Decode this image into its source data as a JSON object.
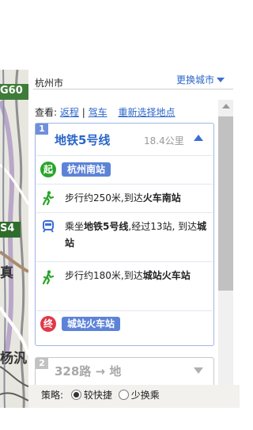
{
  "map": {
    "labels": [
      "G60",
      "S4",
      "真",
      "杨汎"
    ]
  },
  "header": {
    "city": "杭州市",
    "change_city": "更换城市"
  },
  "viewline": {
    "label": "查看:",
    "return_link": "返程",
    "separator": "|",
    "drive_link": "驾车",
    "reselect_link": "重新选择地点"
  },
  "route1": {
    "index": "1",
    "title": "地铁5号线",
    "distance": "18.4公里",
    "start_badge": "起",
    "start_name": "杭州南站",
    "walk1": {
      "prefix": "步行约250米,到达",
      "target": "火车南站"
    },
    "ride": {
      "prefix": "乘坐",
      "line": "地铁5号线",
      "middle": ",经过13站, 到达",
      "target": "城站"
    },
    "walk2": {
      "prefix": "步行约180米,到达",
      "target": "城站火车站"
    },
    "end_badge": "终",
    "end_name": "城站火车站"
  },
  "route2": {
    "index": "2",
    "title": "328路 → 地"
  },
  "strategy": {
    "label": "策略:",
    "option1": "较快捷",
    "option2": "少换乘"
  },
  "colors": {
    "accent": "#2b66c9",
    "start": "#2aa52a",
    "end": "#e0384a",
    "stop": "#5d83d8"
  }
}
